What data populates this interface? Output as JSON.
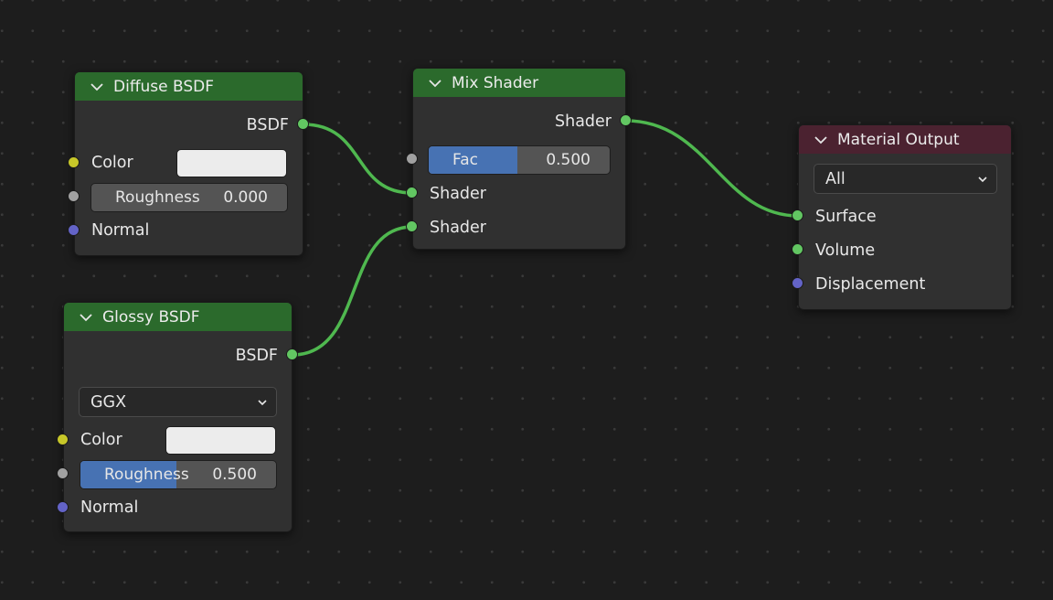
{
  "colors": {
    "shader_header": "#2b6a2c",
    "output_header": "#4b2230",
    "node_body": "#303030",
    "socket_shader": "#62c662",
    "socket_color": "#c7c729",
    "socket_float": "#a1a1a1",
    "socket_vector": "#6363c7",
    "slider_fill": "#4772b3",
    "wire": "#4fb84f"
  },
  "nodes": {
    "diffuse": {
      "title": "Diffuse BSDF",
      "output_label": "BSDF",
      "color_label": "Color",
      "roughness_label": "Roughness",
      "roughness_value": "0.000",
      "roughness_fraction": 0.0,
      "normal_label": "Normal"
    },
    "glossy": {
      "title": "Glossy BSDF",
      "output_label": "BSDF",
      "distribution": "GGX",
      "color_label": "Color",
      "roughness_label": "Roughness",
      "roughness_value": "0.500",
      "roughness_fraction": 0.5,
      "normal_label": "Normal"
    },
    "mix": {
      "title": "Mix Shader",
      "output_label": "Shader",
      "fac_label": "Fac",
      "fac_value": "0.500",
      "fac_fraction": 0.5,
      "input1_label": "Shader",
      "input2_label": "Shader"
    },
    "output": {
      "title": "Material Output",
      "target": "All",
      "surface_label": "Surface",
      "volume_label": "Volume",
      "displacement_label": "Displacement"
    }
  }
}
